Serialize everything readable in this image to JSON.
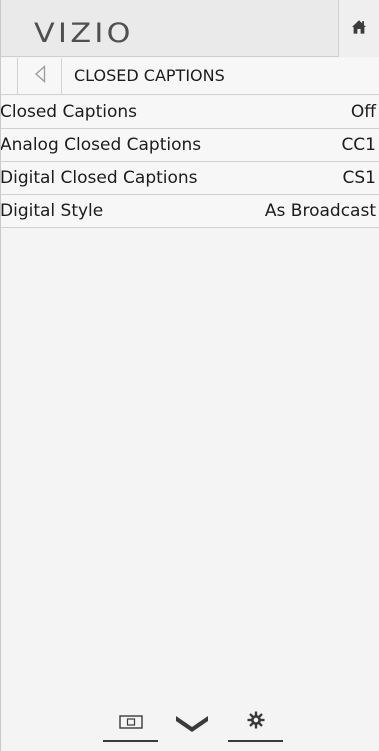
{
  "header": {
    "logo_text": "VIZIO",
    "home_icon": "home-icon"
  },
  "breadcrumb": {
    "back_icon": "back-arrow-icon",
    "title": "CLOSED CAPTIONS"
  },
  "menu": {
    "items": [
      {
        "label": "Closed Captions",
        "value": "Off"
      },
      {
        "label": "Analog Closed Captions",
        "value": "CC1"
      },
      {
        "label": "Digital Closed Captions",
        "value": "CS1"
      },
      {
        "label": "Digital Style",
        "value": "As Broadcast"
      }
    ]
  },
  "bottom_nav": {
    "icons": [
      "input-icon",
      "vizio-v-icon",
      "settings-gear-icon"
    ]
  },
  "colors": {
    "background": "#f4f4f4",
    "header_bg": "#eaeaea",
    "text": "#1c1c1c",
    "logo": "#505050",
    "divider": "#d0d0d0"
  }
}
